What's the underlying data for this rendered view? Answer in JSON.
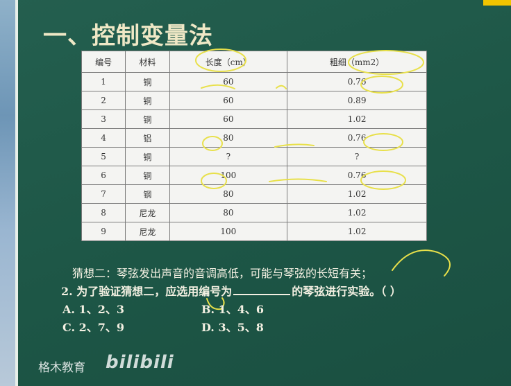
{
  "title": "一、控制变量法",
  "table": {
    "headers": [
      "编号",
      "材料",
      "长度（cm）",
      "粗细（mm2）"
    ],
    "rows": [
      [
        "1",
        "铜",
        "60",
        "0.76"
      ],
      [
        "2",
        "铜",
        "60",
        "0.89"
      ],
      [
        "3",
        "铜",
        "60",
        "1.02"
      ],
      [
        "4",
        "铝",
        "80",
        "0.76"
      ],
      [
        "5",
        "铜",
        "?",
        "?"
      ],
      [
        "6",
        "铜",
        "100",
        "0.76"
      ],
      [
        "7",
        "钢",
        "80",
        "1.02"
      ],
      [
        "8",
        "尼龙",
        "80",
        "1.02"
      ],
      [
        "9",
        "尼龙",
        "100",
        "1.02"
      ]
    ]
  },
  "question": {
    "hypothesis": "猜想二：琴弦发出声音的音调高低，可能与琴弦的长短有关；",
    "prompt_before": "2. 为了验证猜想二，应选用编号为",
    "prompt_after": "的琴弦进行实验。（ ）",
    "options": {
      "A": "A. 1、2、3",
      "B": "B. 1、4、6",
      "C": "C. 2、7、9",
      "D": "D. 3、5、8"
    }
  },
  "watermark": {
    "brand": "格木教育",
    "logo": "bilibili"
  },
  "colors": {
    "board": "#1f5a4a",
    "highlight": "#e8e04a"
  }
}
